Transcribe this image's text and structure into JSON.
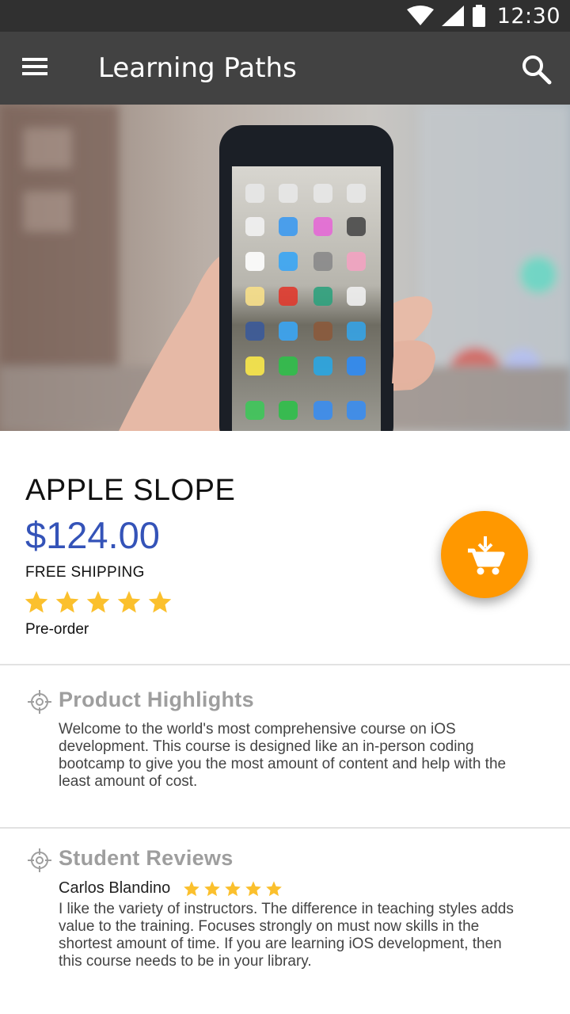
{
  "status_bar": {
    "time": "12:30",
    "icons": [
      "wifi-icon",
      "signal-icon",
      "battery-icon"
    ],
    "background": "#303030"
  },
  "app_bar": {
    "title": "Learning Paths",
    "left_icon": "menu-icon",
    "right_icon": "search-icon",
    "background": "#424242"
  },
  "product": {
    "name": "APPLE SLOPE",
    "price": "$124.00",
    "shipping": "FREE SHIPPING",
    "rating": 5,
    "rating_max": 5,
    "status": "Pre-order",
    "price_color": "#3453b8",
    "star_color": "#fbc02d",
    "fab_icon": "add-to-cart-download-icon",
    "fab_color": "#ff9800"
  },
  "highlights": {
    "icon": "crosshair-icon",
    "title": "Product Highlights",
    "body": "Welcome to the world's most comprehensive course on iOS development. This course is designed like an in-person coding bootcamp to give you the most amount of content and help with the least amount of cost."
  },
  "reviews": {
    "icon": "crosshair-icon",
    "title": "Student Reviews",
    "items": [
      {
        "reviewer": "Carlos Blandino",
        "rating": 5,
        "text": "I like the variety of instructors. The difference in teaching styles adds value to the training. Focuses strongly on must now skills in the shortest amount of time. If you are learning iOS development, then this course needs to be in your library."
      }
    ]
  }
}
